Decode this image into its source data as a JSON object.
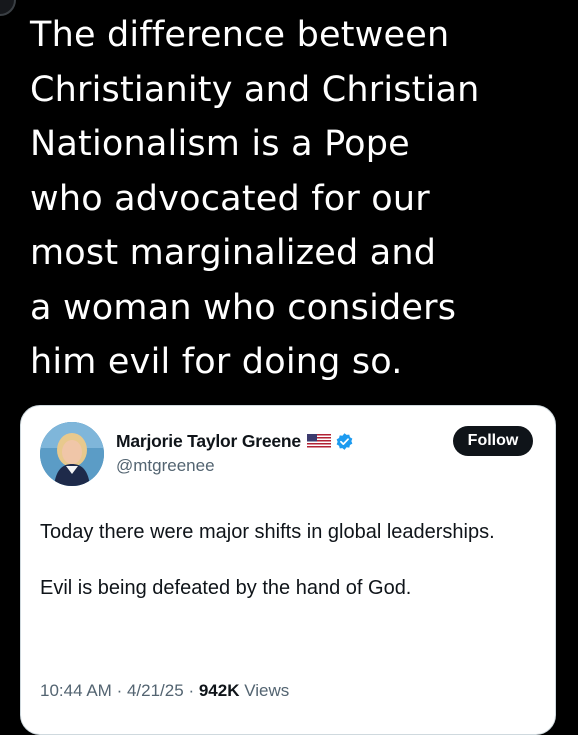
{
  "post": {
    "text": "The difference between\nChristianity and Christian\nNationalism is a Pope\nwho advocated for our\nmost marginalized and\na woman who considers\nhim evil for doing so."
  },
  "quoted_tweet": {
    "author": {
      "display_name": "Marjorie Taylor Greene",
      "handle": "@mtgreenee",
      "flag_icon": "us-flag-icon",
      "verified_icon": "verified-badge-icon",
      "verified_color": "#1d9bf0"
    },
    "follow_label": "Follow",
    "body": {
      "paragraph_1": "Today there were major shifts in global leaderships.",
      "paragraph_2": "Evil is being defeated by the hand of God."
    },
    "meta": {
      "time": "10:44 AM",
      "separator": "·",
      "date": "4/21/25",
      "views_count": "942K",
      "views_label": "Views"
    }
  },
  "colors": {
    "background": "#000000",
    "headline_text": "#ffffff",
    "card_background": "#ffffff",
    "primary_text": "#0f1419",
    "secondary_text": "#536471",
    "follow_button_bg": "#0f1419"
  }
}
